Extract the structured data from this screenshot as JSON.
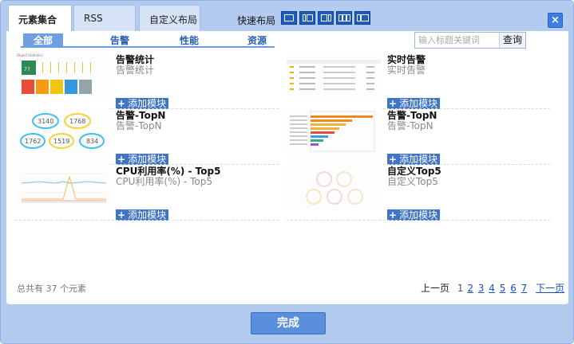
{
  "tabs": [
    {
      "label": "元素集合",
      "active": true
    },
    {
      "label": "RSS",
      "active": false
    },
    {
      "label": "自定义布局",
      "active": false
    }
  ],
  "quick_layout_label": "快速布局",
  "close_glyph": "×",
  "categories": [
    {
      "label": "全部",
      "active": true
    },
    {
      "label": "告警",
      "active": false
    },
    {
      "label": "性能",
      "active": false
    },
    {
      "label": "资源",
      "active": false
    }
  ],
  "search": {
    "placeholder": "输入标题关键词",
    "button": "查询"
  },
  "add_label": "添加模块",
  "cards": [
    {
      "title": "告警统计",
      "subtitle": "告警统计"
    },
    {
      "title": "实时告警",
      "subtitle": "实时告警"
    },
    {
      "title": "告警-TopN",
      "subtitle": "告警-TopN"
    },
    {
      "title": "告警-TopN",
      "subtitle": "告警-TopN"
    },
    {
      "title": "CPU利用率(%) - Top5",
      "subtitle": "CPU利用率(%) - Top5"
    },
    {
      "title": "自定义Top5",
      "subtitle": "自定义Top5"
    }
  ],
  "thumb_text": {
    "stat_header": "Object Statistics",
    "stat_value": "77",
    "bubbles": [
      "3140",
      "1768",
      "1762",
      "1519",
      "834"
    ]
  },
  "footer": {
    "total": "总共有 37 个元素",
    "prev": "上一页",
    "pages": [
      "1",
      "2",
      "3",
      "4",
      "5",
      "6",
      "7"
    ],
    "next": "下一页"
  },
  "done_label": "完成",
  "colors": {
    "dialog_bg": "#b3cbee",
    "accent": "#3f74c6",
    "category_active": "#6e9fe0",
    "link": "#1d4fb8"
  }
}
